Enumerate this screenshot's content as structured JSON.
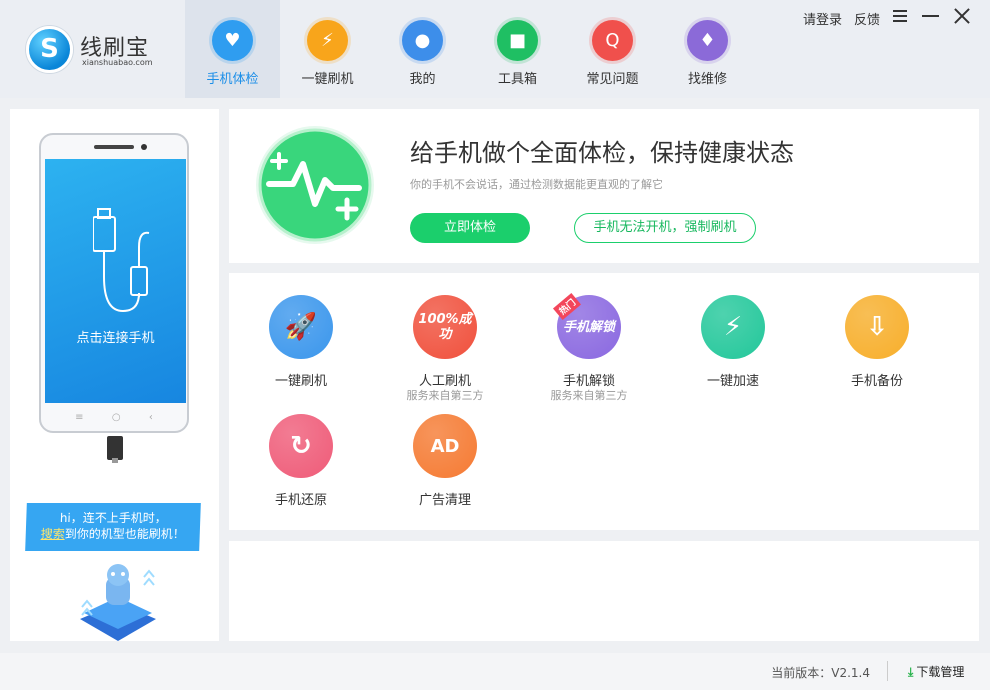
{
  "app": {
    "logo_glyph": "S",
    "name": "线刷宝",
    "domain": "xianshuabao.com"
  },
  "nav": [
    {
      "label": "手机体检",
      "icon": "phone-heart-icon",
      "color": "#2f9df0",
      "active": true
    },
    {
      "label": "一键刷机",
      "icon": "lightning-phone-icon",
      "color": "#f8a51b",
      "active": false
    },
    {
      "label": "我的",
      "icon": "user-icon",
      "color": "#3d8eea",
      "active": false
    },
    {
      "label": "工具箱",
      "icon": "toolbox-icon",
      "color": "#1fbf63",
      "active": false
    },
    {
      "label": "常见问题",
      "icon": "question-icon",
      "color": "#f0504c",
      "active": false
    },
    {
      "label": "找维修",
      "icon": "repairman-icon",
      "color": "#8b6ad8",
      "active": false
    }
  ],
  "top_links": {
    "login": "请登录",
    "feedback": "反馈"
  },
  "left_panel": {
    "phone_label": "点击连接手机",
    "hint_line1": "hi，连不上手机时，",
    "hint_link": "搜索",
    "hint_line2_rest": "到你的机型也能刷机！"
  },
  "check": {
    "title": "给手机做个全面体检，保持健康状态",
    "subtitle": "你的手机不会说话，通过检测数据能更直观的了解它",
    "primary_button": "立即体检",
    "secondary_button": "手机无法开机，强制刷机"
  },
  "tools": [
    {
      "label": "一键刷机",
      "sub": "",
      "icon": "rocket-icon",
      "color": "#3a96ec"
    },
    {
      "label": "人工刷机",
      "sub": "服务来自第三方",
      "icon": "100-success-icon",
      "color": "#f0503c",
      "badge_text": "100%成功"
    },
    {
      "label": "手机解锁",
      "sub": "服务来自第三方",
      "icon": "unlock-icon",
      "color": "#8a68e0",
      "badge_text": "手机解锁",
      "hot": "热门"
    },
    {
      "label": "一键加速",
      "sub": "",
      "icon": "lightning-icon",
      "color": "#22c79a"
    },
    {
      "label": "手机备份",
      "sub": "",
      "icon": "usb-drive-icon",
      "color": "#f7ae2a"
    },
    {
      "label": "手机还原",
      "sub": "",
      "icon": "restore-phone-icon",
      "color": "#ef5b78"
    },
    {
      "label": "广告清理",
      "sub": "",
      "icon": "ad-clean-icon",
      "color": "#f57a32",
      "badge_text": "AD"
    }
  ],
  "status": {
    "version": "当前版本：V2.1.4",
    "download": "下载管理"
  }
}
